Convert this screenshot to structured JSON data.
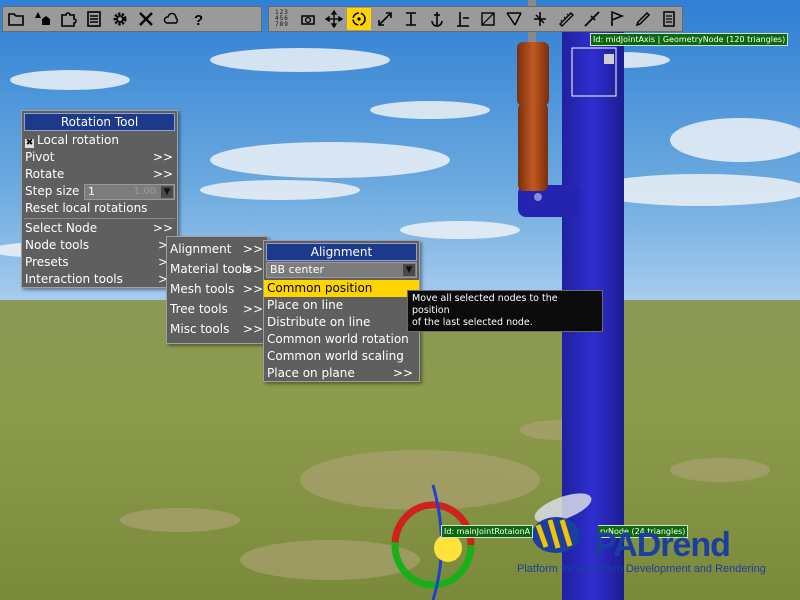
{
  "toolbar": {
    "left_icons": [
      "folder-icon",
      "tree-house-icon",
      "puzzle-icon",
      "list-icon",
      "gear-icon",
      "tools-icon",
      "cloud-icon",
      "help-icon"
    ],
    "numpad_label": "123\n456\n789",
    "right_icons": [
      "camera-icon",
      "move-icon",
      "rotate-icon",
      "scale-icon",
      "snap-icon",
      "anchor-icon",
      "pillar-icon",
      "frame-icon",
      "align-icon",
      "arrows-icon",
      "ruler-icon",
      "brush-icon",
      "flag-icon",
      "pen-icon",
      "document-icon"
    ]
  },
  "rotation_menu": {
    "title": "Rotation Tool",
    "local_rotation_label": "Local rotation",
    "local_rotation_checked": "✖",
    "pivot_label": "Pivot",
    "rotate_label": "Rotate",
    "step_size_label": "Step size",
    "step_size_value": "1",
    "step_size_ghost": "1.00",
    "reset_label": "Reset local rotations",
    "select_node_label": "Select Node",
    "node_tools_label": "Node tools",
    "presets_label": "Presets",
    "interaction_tools_label": "Interaction tools",
    "sub_arrow": ">>",
    "single_arrow": ">"
  },
  "node_tools_menu": {
    "items": [
      "Alignment",
      "Material tools",
      "Mesh tools",
      "Tree tools",
      "Misc tools"
    ],
    "arrow": ">>"
  },
  "alignment_menu": {
    "title": "Alignment",
    "combo_value": "BB center",
    "items": [
      "Common position",
      "Place on line",
      "Distribute on line",
      "Common world rotation",
      "Common world scaling",
      "Place on plane"
    ],
    "place_on_plane_arrow": ">>",
    "highlight_index": 0
  },
  "tooltip": {
    "line1": "Move all selected nodes to the position",
    "line2": "of the last selected node."
  },
  "node_labels": {
    "top": "Id: midJointAxis | GeometryNode (120 triangles)",
    "bottom": "Id: mainJointRotaionA",
    "bottom_right": "ryNode (24 triangles)"
  },
  "logo": {
    "text": "PADrend",
    "tagline": "Platform for Algorithm Development and Rendering"
  },
  "colors": {
    "accent": "#ffd400",
    "title_bar": "#1d3a8a",
    "menu_bg": "#5f5f5f",
    "robot_blue": "#2a2ab8",
    "robot_orange": "#b04a1a"
  }
}
